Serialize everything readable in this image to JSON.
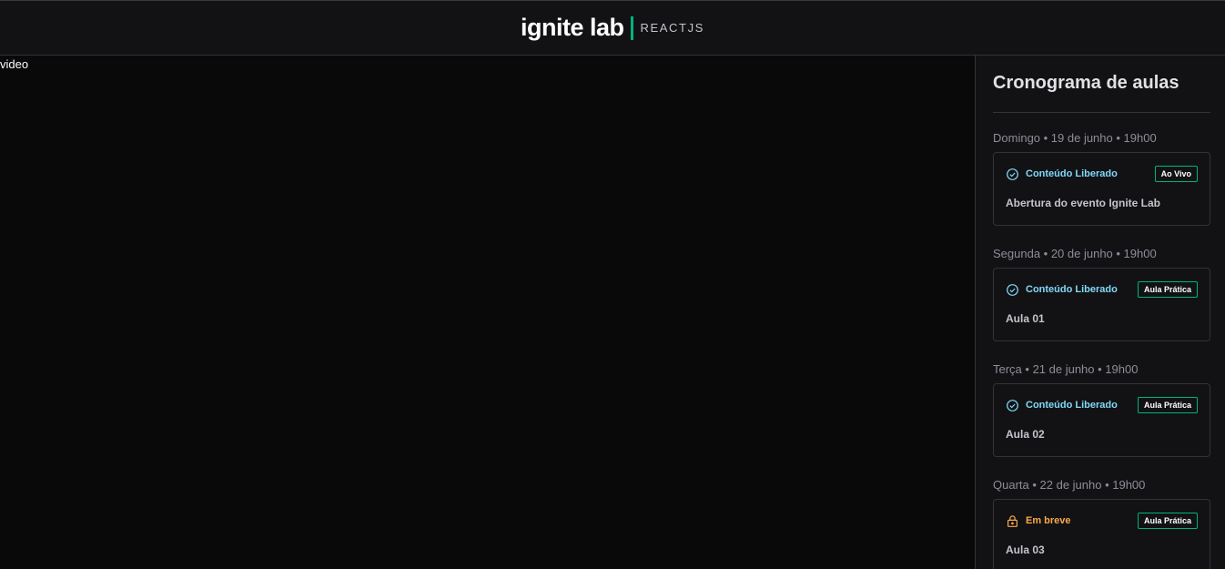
{
  "header": {
    "logo_word": "ignite lab",
    "logo_sub": "REACTJS"
  },
  "main": {
    "video_label": "video"
  },
  "schedule": {
    "title": "Cronograma de aulas",
    "lessons": [
      {
        "date": "Domingo • 19 de junho • 19h00",
        "status": "Conteúdo Liberado",
        "status_icon": "check-circle-icon",
        "badge": "Ao Vivo",
        "title": "Abertura do evento Ignite Lab"
      },
      {
        "date": "Segunda • 20 de junho • 19h00",
        "status": "Conteúdo Liberado",
        "status_icon": "check-circle-icon",
        "badge": "Aula Prática",
        "title": "Aula 01"
      },
      {
        "date": "Terça • 21 de junho • 19h00",
        "status": "Conteúdo Liberado",
        "status_icon": "check-circle-icon",
        "badge": "Aula Prática",
        "title": "Aula 02"
      },
      {
        "date": "Quarta • 22 de junho • 19h00",
        "status": "Em breve",
        "status_icon": "lock-icon",
        "badge": "Aula Prática",
        "title": "Aula 03"
      }
    ]
  },
  "colors": {
    "accent_green": "#00b37e",
    "released_blue": "#81d8f7",
    "soon_orange": "#fba94c",
    "background": "#09090a",
    "panel": "#121214"
  }
}
